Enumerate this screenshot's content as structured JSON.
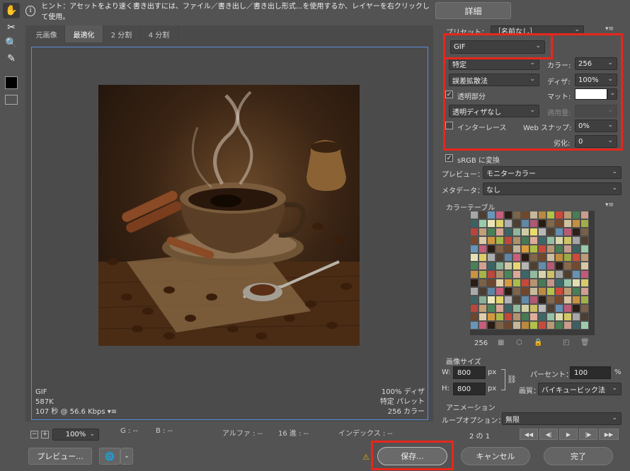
{
  "hint": {
    "text": "ヒント：アセットをより速く書き出すには、ファイル／書き出し／書き出し形式...を使用するか、レイヤーを右クリックして使用。",
    "details_button": "詳細"
  },
  "tabs": [
    "元画像",
    "最適化",
    "2 分割",
    "4 分割"
  ],
  "image_info": {
    "format": "GIF",
    "size": "587K",
    "time": "107 秒 @ 56.6 Kbps",
    "dither": "100% ディザ",
    "palette": "特定 パレット",
    "colors": "256 カラー"
  },
  "zoom": "100%",
  "readouts": {
    "g": "G : --",
    "b": "B : --",
    "alpha": "アルファ : --",
    "hex": "16 進 : --",
    "index": "インデックス : --"
  },
  "settings": {
    "preset_label": "プリセット：",
    "preset_value": "［名前なし］",
    "format": "GIF",
    "reduction": "特定",
    "colors_label": "カラー:",
    "colors_value": "256",
    "dither_algo": "誤差拡散法",
    "dither_label": "ディザ:",
    "dither_value": "100%",
    "transparency": "透明部分",
    "matte_label": "マット:",
    "trans_dither": "透明ディザなし",
    "amount_label": "適用量:",
    "interlaced": "インターレース",
    "websnap_label": "Web スナップ:",
    "websnap_value": "0%",
    "lossy_label": "劣化:",
    "lossy_value": "0"
  },
  "srgb": "sRGB に変換",
  "preview_label": "プレビュー：",
  "preview_value": "モニターカラー",
  "metadata_label": "メタデータ：",
  "metadata_value": "なし",
  "color_table_label": "カラーテーブル",
  "color_count": "256",
  "image_size": {
    "title": "画像サイズ",
    "w_label": "W:",
    "w_value": "800",
    "h_label": "H:",
    "h_value": "800",
    "unit": "px",
    "percent_label": "パーセント：",
    "percent_value": "100",
    "percent_unit": "%",
    "quality_label": "画質：",
    "quality_value": "バイキュービック法"
  },
  "animation": {
    "title": "アニメーション",
    "loop_label": "ループオプション：",
    "loop_value": "無限",
    "frame": "2 の 1"
  },
  "buttons": {
    "preview": "プレビュー...",
    "save": "保存...",
    "cancel": "キャンセル",
    "done": "完了"
  }
}
